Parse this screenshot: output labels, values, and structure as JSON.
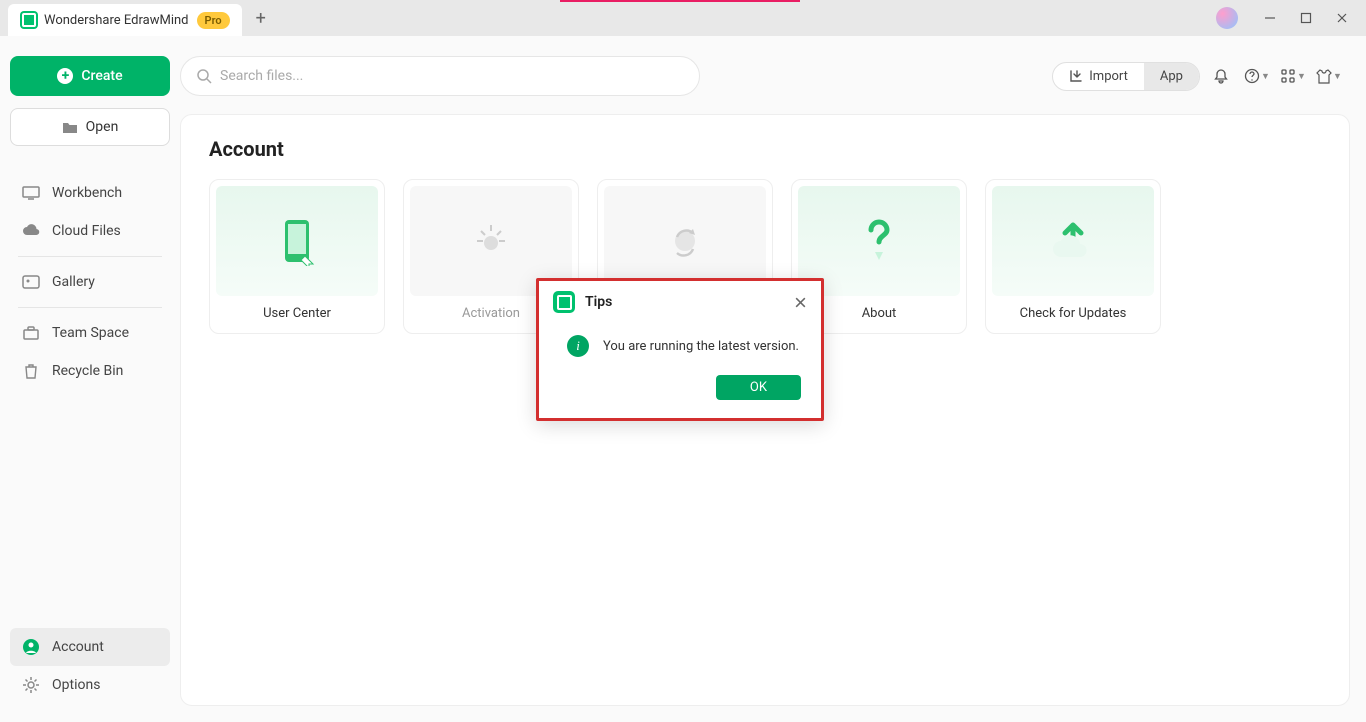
{
  "titlebar": {
    "app_name": "Wondershare EdrawMind",
    "pro_badge": "Pro"
  },
  "sidebar": {
    "create_label": "Create",
    "open_label": "Open",
    "items": [
      {
        "label": "Workbench"
      },
      {
        "label": "Cloud Files"
      },
      {
        "label": "Gallery"
      },
      {
        "label": "Team Space"
      },
      {
        "label": "Recycle Bin"
      }
    ],
    "bottom": [
      {
        "label": "Account"
      },
      {
        "label": "Options"
      }
    ]
  },
  "search": {
    "placeholder": "Search files..."
  },
  "toolbar": {
    "import_label": "Import",
    "app_label": "App"
  },
  "panel": {
    "title": "Account",
    "cards": [
      {
        "label": "User Center"
      },
      {
        "label": "Activation"
      },
      {
        "label": ""
      },
      {
        "label": "About"
      },
      {
        "label": "Check for Updates"
      }
    ]
  },
  "dialog": {
    "title": "Tips",
    "message": "You are running the latest version.",
    "ok_label": "OK"
  }
}
